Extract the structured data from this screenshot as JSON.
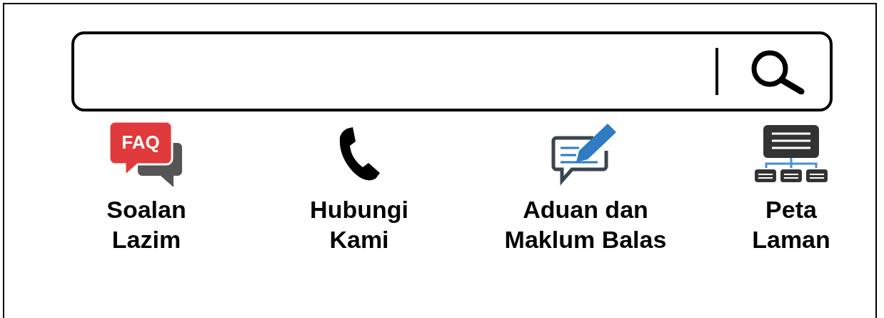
{
  "search": {
    "has_cursor": true
  },
  "links": [
    {
      "kind": "faq",
      "badge": "FAQ",
      "label": [
        "Soalan",
        "Lazim"
      ]
    },
    {
      "kind": "phone",
      "label": [
        "Hubungi",
        "Kami"
      ]
    },
    {
      "kind": "feedback",
      "label": [
        "Aduan dan",
        "Maklum Balas"
      ]
    },
    {
      "kind": "sitemap",
      "label": [
        "Peta",
        "Laman"
      ]
    }
  ]
}
